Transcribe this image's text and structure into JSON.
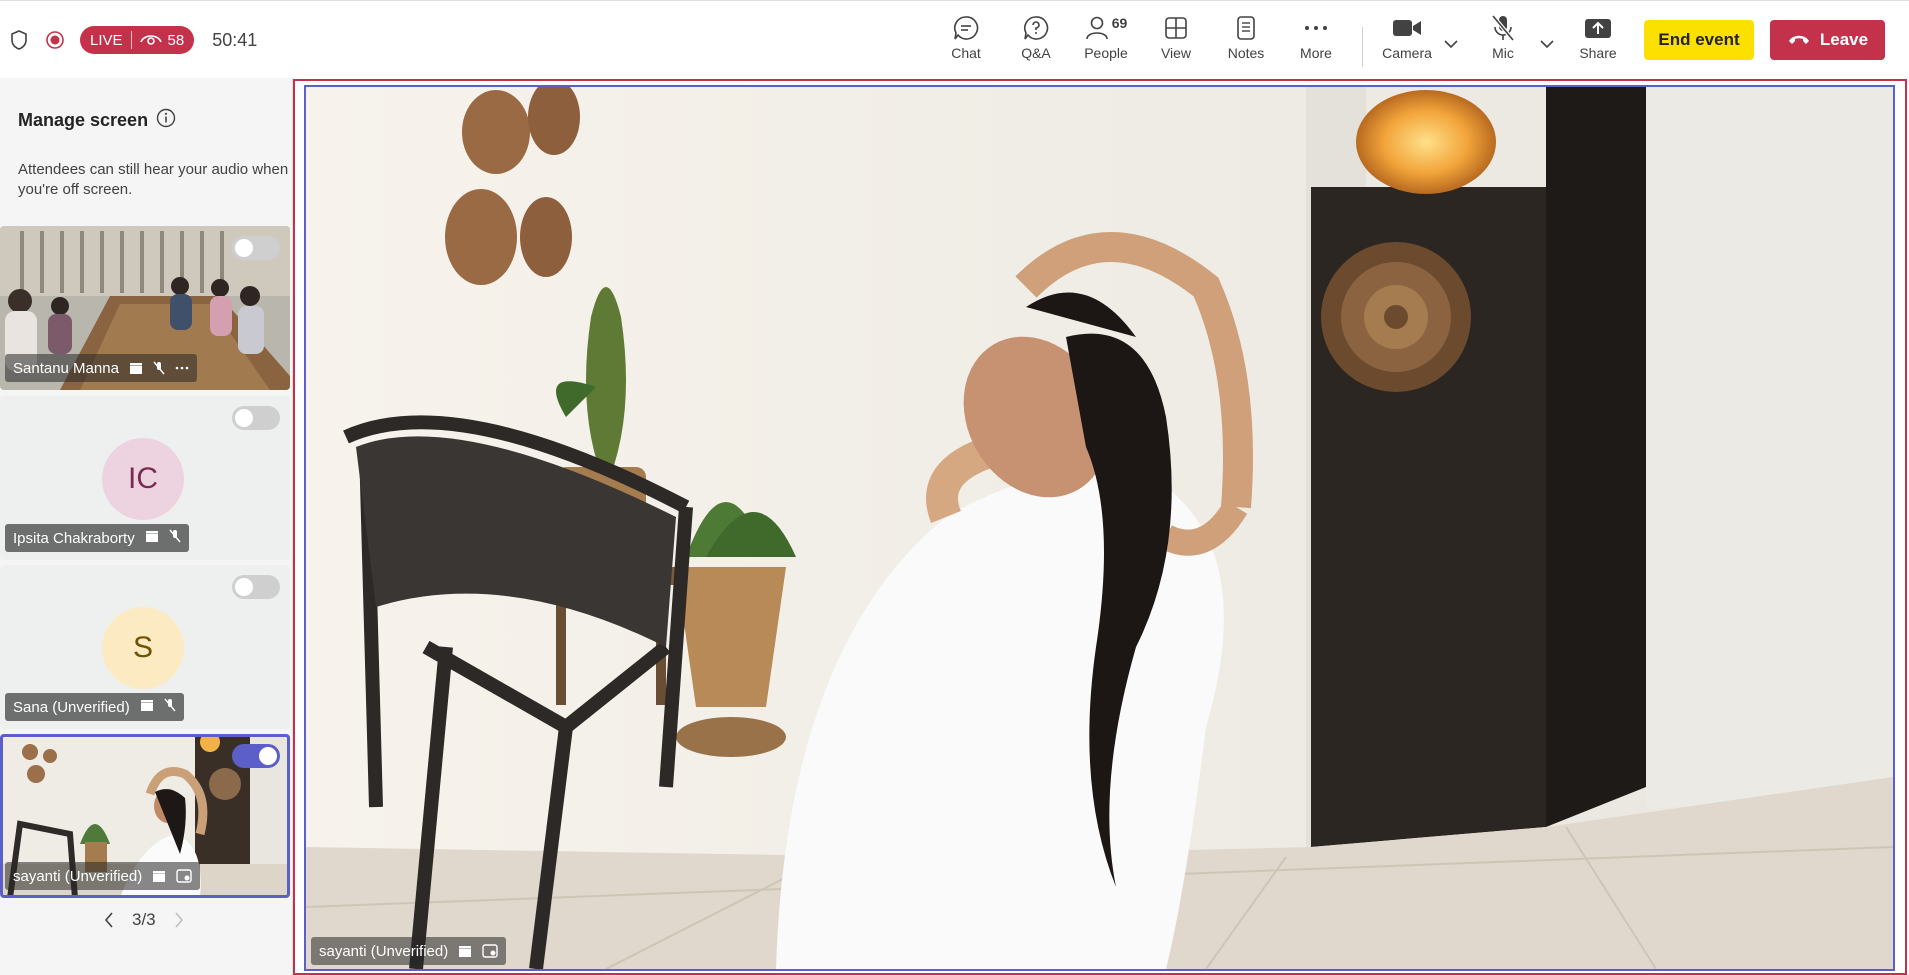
{
  "header": {
    "live_label": "LIVE",
    "viewer_count": "58",
    "timer": "50:41",
    "actions": {
      "chat": "Chat",
      "qa": "Q&A",
      "people": "People",
      "people_count": "69",
      "view": "View",
      "notes": "Notes",
      "more": "More",
      "camera": "Camera",
      "mic": "Mic",
      "share": "Share"
    },
    "end_event": "End event",
    "leave": "Leave"
  },
  "panel": {
    "title": "Manage screen",
    "description": "Attendees can still hear your audio when you're off screen.",
    "participants": [
      {
        "name": "Santanu Manna",
        "on_screen": false,
        "type": "video"
      },
      {
        "name": "Ipsita Chakraborty",
        "initials": "IC",
        "on_screen": false,
        "type": "avatar",
        "avatar_color": "#ecd3df",
        "initials_color": "#7a2b53"
      },
      {
        "name": "Sana (Unverified)",
        "initials": "S",
        "on_screen": false,
        "type": "avatar",
        "avatar_color": "#fbeac2",
        "initials_color": "#6e5400"
      },
      {
        "name": "sayanti (Unverified)",
        "on_screen": true,
        "type": "video",
        "selected": true
      }
    ],
    "pagination": "3/3"
  },
  "stage": {
    "speaker_name": "sayanti (Unverified)"
  },
  "colors": {
    "accent": "#5b5fc7",
    "live_red": "#c4314b",
    "end_event_yellow": "#fce100"
  }
}
